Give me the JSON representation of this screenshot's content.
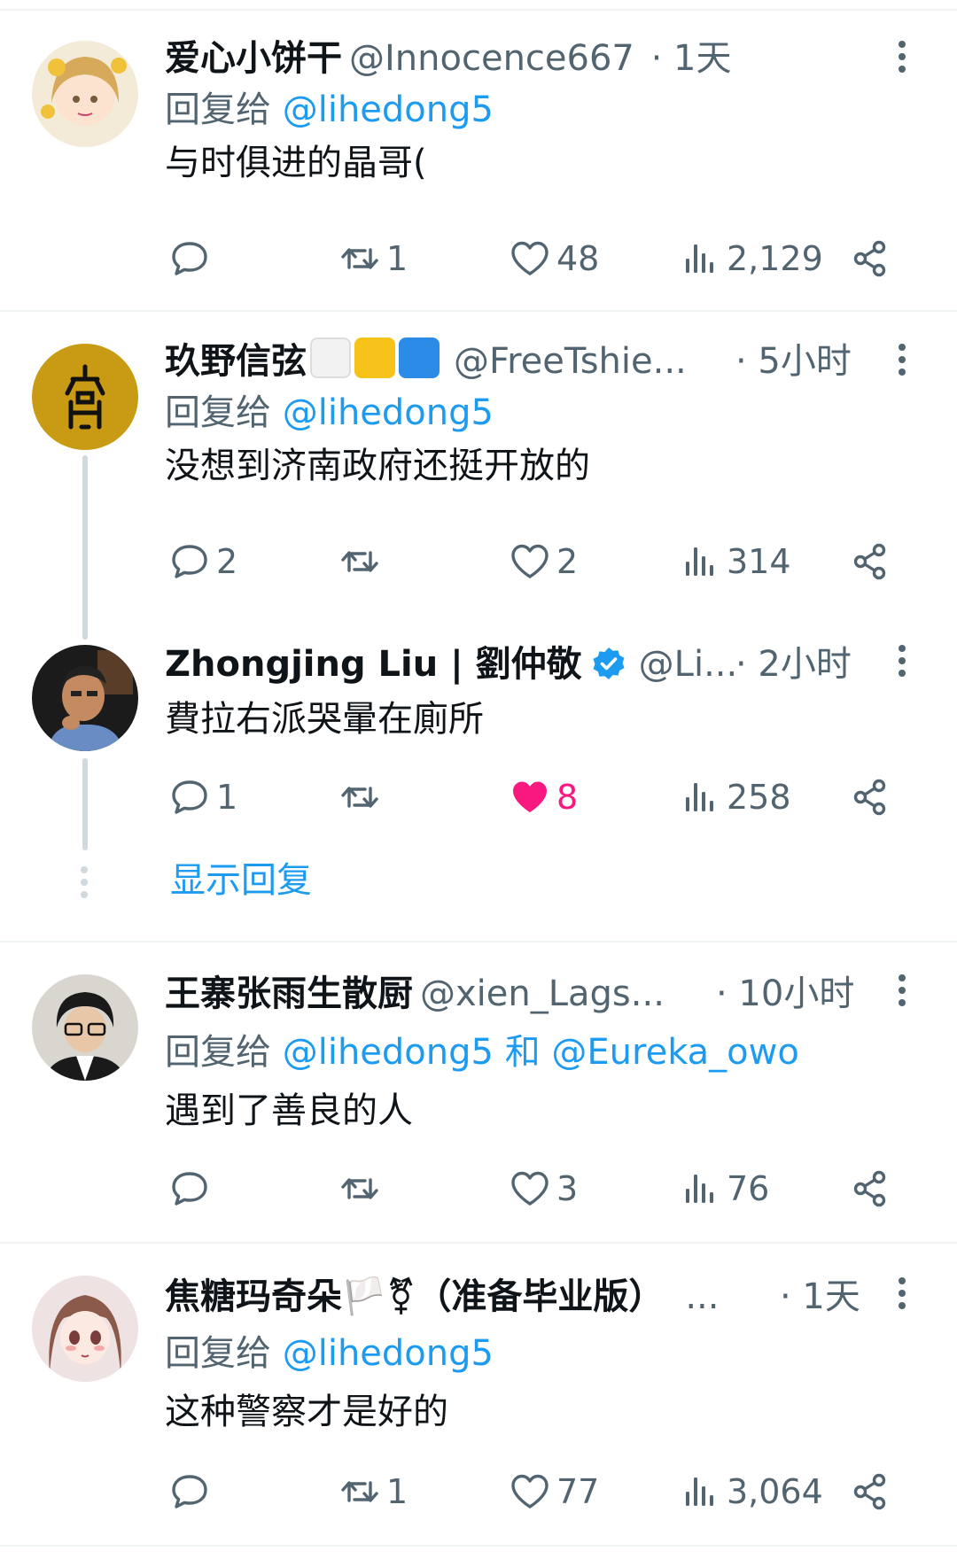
{
  "tweets": [
    {
      "name": "爱心小饼干",
      "handle": "@Innocence667",
      "time": "· 1天",
      "reply_prefix": "回复给",
      "reply_to": "@lihedong5",
      "text": "与时俱进的晶哥(",
      "replies": "",
      "retweets": "1",
      "likes": "48",
      "views": "2,129"
    },
    {
      "name": "玖野信弦",
      "handle": "@FreeTshie...",
      "time": "· 5小时",
      "reply_prefix": "回复给",
      "reply_to": "@lihedong5",
      "text": "没想到济南政府还挺开放的",
      "replies": "2",
      "retweets": "",
      "likes": "2",
      "views": "314"
    },
    {
      "name": "Zhongjing Liu | 劉仲敬",
      "handle": "@Li...",
      "time": "· 2小时",
      "text": "費拉右派哭暈在廁所",
      "replies": "1",
      "retweets": "",
      "likes": "8",
      "views": "258",
      "show_replies": "显示回复"
    },
    {
      "name": "王寨张雨生散厨",
      "handle": "@xien_Lags...",
      "time": "· 10小时",
      "reply_prefix": "回复给",
      "reply_to": "@lihedong5",
      "reply_and": "和",
      "reply_to2": "@Eureka_owo",
      "text": "遇到了善良的人",
      "replies": "",
      "retweets": "",
      "likes": "3",
      "views": "76"
    },
    {
      "name": "焦糖玛奇朵🏳️⚧（准备毕业版）",
      "handle": "...",
      "time": "· 1天",
      "reply_prefix": "回复给",
      "reply_to": "@lihedong5",
      "text": "这种警察才是好的",
      "replies": "",
      "retweets": "1",
      "likes": "77",
      "views": "3,064"
    }
  ],
  "colors": {
    "link": "#1d9bf0",
    "secondary": "#536471",
    "liked": "#f91880",
    "verified": "#1d9bf0",
    "avatar2": "#c99a14"
  },
  "icons": [
    "reply-icon",
    "retweet-icon",
    "like-icon",
    "views-icon",
    "share-icon",
    "more-icon",
    "verified-badge-icon"
  ]
}
